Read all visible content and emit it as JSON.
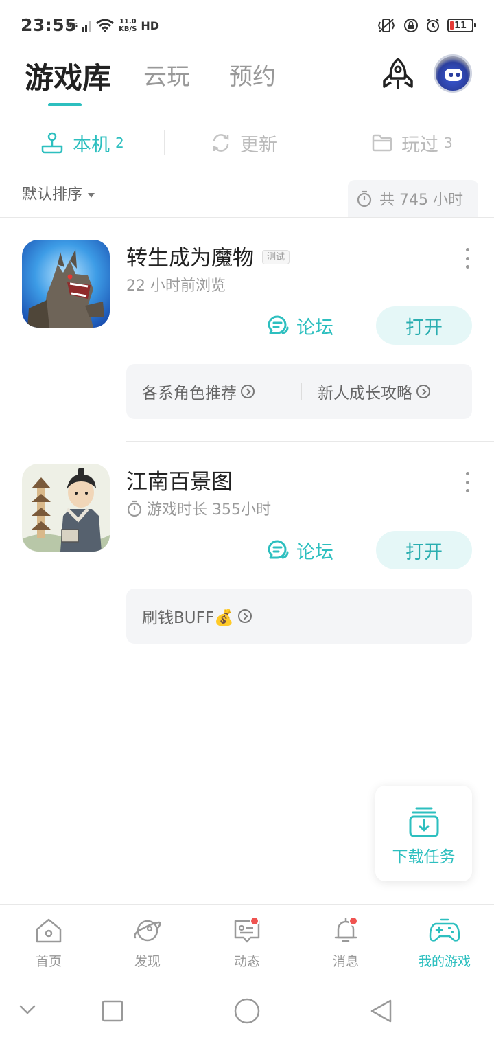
{
  "status_bar": {
    "time": "23:55",
    "network": "4G",
    "speed_value": "11.0",
    "speed_unit": "KB/S",
    "hd": "HD",
    "battery": "11"
  },
  "top_tabs": [
    {
      "label": "游戏库",
      "active": true
    },
    {
      "label": "云玩",
      "active": false
    },
    {
      "label": "预约",
      "active": false
    }
  ],
  "sub_tabs": [
    {
      "label": "本机",
      "count": "2",
      "icon": "joystick-icon",
      "active": true
    },
    {
      "label": "更新",
      "count": "",
      "icon": "refresh-icon",
      "active": false
    },
    {
      "label": "玩过",
      "count": "3",
      "icon": "folder-icon",
      "active": false
    }
  ],
  "sort_label": "默认排序",
  "total_time": "共 745 小时",
  "games": [
    {
      "title": "转生成为魔物",
      "badge": "测试",
      "subtitle": "22 小时前浏览",
      "forum_label": "论坛",
      "open_label": "打开",
      "tips": [
        "各系角色推荐",
        "新人成长攻略"
      ]
    },
    {
      "title": "江南百景图",
      "badge": "",
      "subtitle": "游戏时长 355小时",
      "forum_label": "论坛",
      "open_label": "打开",
      "tips": [
        "刷钱BUFF💰"
      ]
    }
  ],
  "download_task": "下载任务",
  "bottom_nav": [
    {
      "label": "首页",
      "icon": "home-icon",
      "badge": false,
      "active": false
    },
    {
      "label": "发现",
      "icon": "planet-icon",
      "badge": false,
      "active": false
    },
    {
      "label": "动态",
      "icon": "feed-icon",
      "badge": true,
      "active": false
    },
    {
      "label": "消息",
      "icon": "bell-icon",
      "badge": true,
      "active": false
    },
    {
      "label": "我的游戏",
      "icon": "gamepad-icon",
      "badge": false,
      "active": true
    }
  ],
  "colors": {
    "accent": "#2dbfbf",
    "open_button_bg": "#e5f7f7",
    "badge_red": "#ef5350"
  }
}
